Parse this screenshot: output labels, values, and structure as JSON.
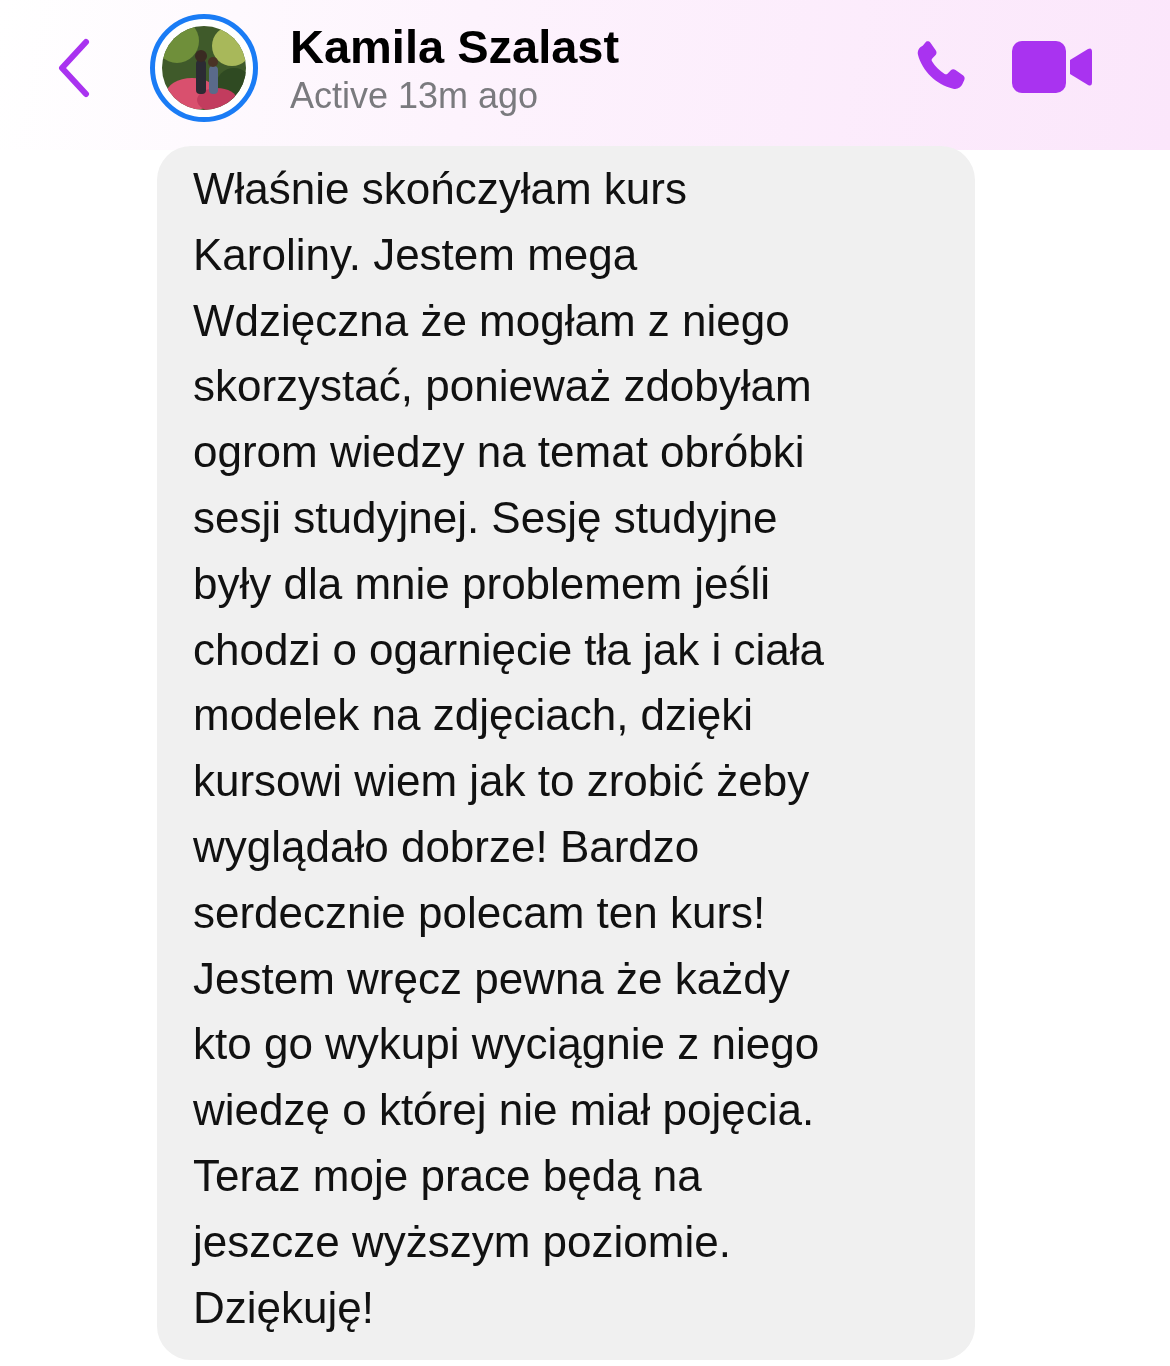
{
  "header": {
    "contact_name": "Kamila Szalast",
    "status": "Active 13m ago",
    "story_ring": true
  },
  "message": {
    "lines": [
      "Właśnie skończyłam kurs",
      "Karoliny. Jestem mega",
      "Wdzięczna że mogłam z niego",
      "skorzystać, ponieważ zdobyłam",
      "ogrom wiedzy na temat obróbki",
      "sesji studyjnej. Sesję studyjne",
      "były dla mnie problemem jeśli",
      "chodzi o ogarnięcie tła jak i ciała",
      "modelek na zdjęciach, dzięki",
      "kursowi wiem jak to zrobić żeby",
      "wyglądało dobrze! Bardzo",
      "serdecznie polecam ten kurs!",
      "Jestem wręcz pewna że każdy",
      "kto go wykupi wyciągnie z niego",
      "wiedzę o której nie miał pojęcia.",
      "Teraz moje prace będą na",
      "jeszcze wyższym poziomie.",
      "Dziękuję!"
    ]
  }
}
